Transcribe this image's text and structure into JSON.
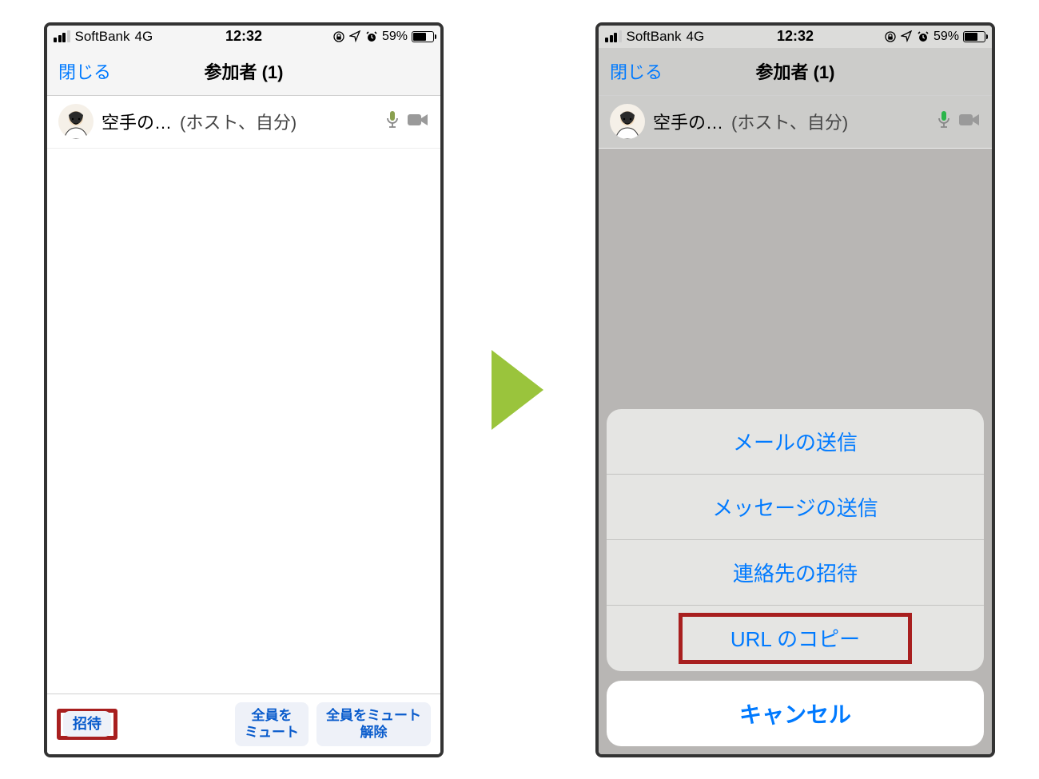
{
  "status": {
    "carrier": "SoftBank",
    "network": "4G",
    "time": "12:32",
    "battery_pct": "59%"
  },
  "header": {
    "close": "閉じる",
    "title": "参加者 (1)"
  },
  "participant": {
    "name": "空手の…",
    "role": "(ホスト、自分)"
  },
  "footer": {
    "invite": "招待",
    "mute_all_line1": "全員を",
    "mute_all_line2": "ミュート",
    "unmute_all_line1": "全員をミュート",
    "unmute_all_line2": "解除"
  },
  "actionsheet": {
    "items": [
      "メールの送信",
      "メッセージの送信",
      "連絡先の招待",
      "URL のコピー"
    ],
    "cancel": "キャンセル"
  }
}
